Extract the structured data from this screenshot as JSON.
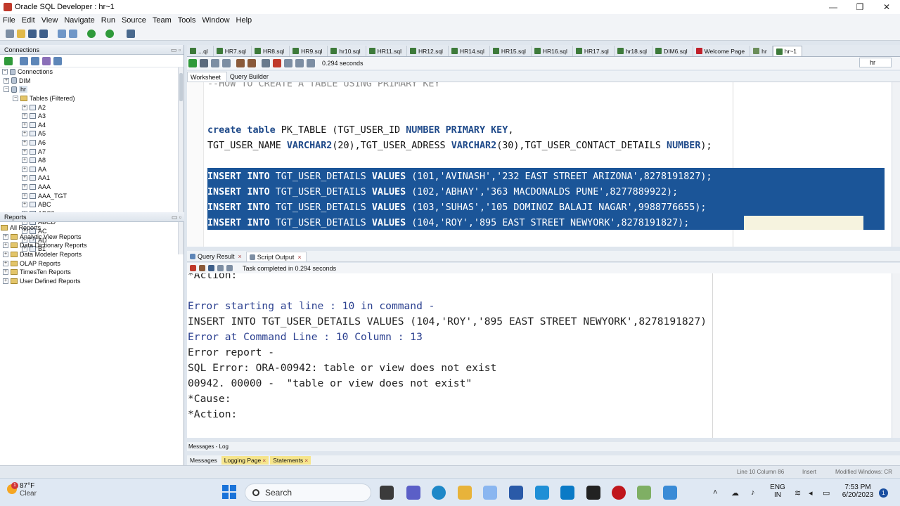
{
  "window": {
    "title": "Oracle SQL Developer : hr~1",
    "controls": [
      "—",
      "❐",
      "✕"
    ]
  },
  "menu": [
    "File",
    "Edit",
    "View",
    "Navigate",
    "Run",
    "Source",
    "Team",
    "Tools",
    "Window",
    "Help"
  ],
  "connections": {
    "header": "Connections",
    "root": "Connections",
    "dim": "DIM",
    "hr": "hr",
    "tables_folder": "Tables (Filtered)",
    "tables": [
      "A2",
      "A3",
      "A4",
      "A5",
      "A6",
      "A7",
      "A8",
      "AA",
      "AA1",
      "AAA",
      "AAA_TGT",
      "ABC",
      "ABC2",
      "ABCD",
      "AC",
      "AD",
      "B1"
    ]
  },
  "reports": {
    "header": "Reports",
    "items": [
      "All Reports",
      "Analytic View Reports",
      "Data Dictionary Reports",
      "Data Modeler Reports",
      "OLAP Reports",
      "TimesTen Reports",
      "User Defined Reports"
    ]
  },
  "editor_tabs": [
    "...ql",
    "HR7.sql",
    "HR8.sql",
    "HR9.sql",
    "hr10.sql",
    "HR11.sql",
    "HR12.sql",
    "HR14.sql",
    "HR15.sql",
    "HR16.sql",
    "HR17.sql",
    "hr18.sql",
    "DIM6.sql",
    "Welcome Page",
    "hr",
    "hr~1"
  ],
  "editor_toolbar": {
    "time": "0.294 seconds",
    "connection": "hr"
  },
  "worksheet_tabs": [
    "Worksheet",
    "Query Builder"
  ],
  "code": {
    "comment": "--HOW TO CREATE A TABLE USING PRIMARY KEY",
    "create_1_kw": "create table",
    "create_1_a": " PK_TABLE (TGT_USER_ID ",
    "create_1_kw2": "NUMBER PRIMARY KEY",
    "create_1_b": ",",
    "create_2_a": "TGT_USER_NAME ",
    "create_2_kw": "VARCHAR2",
    "create_2_b": "(20),TGT_USER_ADRESS ",
    "create_2_kw2": "VARCHAR2",
    "create_2_c": "(30),TGT_USER_CONTACT_DETAILS ",
    "create_2_kw3": "NUMBER",
    "create_2_d": ");",
    "ins_kw1": "INSERT INTO",
    "ins_table": " TGT_USER_DETAILS ",
    "ins_kw2": "VALUES",
    "ins_values": [
      " (101,'AVINASH','232 EAST STREET ARIZONA',8278191827);",
      " (102,'ABHAY','363 MACDONALDS PUNE',8277889922);",
      " (103,'SUHAS','105 DOMINOZ BALAJI NAGAR',9988776655);",
      " (104,'ROY','895 EAST STREET NEWYORK',8278191827);"
    ]
  },
  "output_tabs": [
    "Query Result",
    "Script Output"
  ],
  "output_status": "Task completed in 0.294 seconds",
  "output_lines": [
    "*Action:",
    "",
    "Error starting at line : 10 in command -",
    "INSERT INTO TGT_USER_DETAILS VALUES (104,'ROY','895 EAST STREET NEWYORK',8278191827)",
    "Error at Command Line : 10 Column : 13",
    "Error report -",
    "SQL Error: ORA-00942: table or view does not exist",
    "00942. 00000 -  \"table or view does not exist\"",
    "*Cause:",
    "*Action:"
  ],
  "messages": {
    "header": "Messages - Log",
    "tabs": [
      "Messages",
      "Logging Page",
      "Statements"
    ]
  },
  "statusbar": {
    "position": "Line 10 Column 86",
    "mode": "Insert",
    "state": "Modified Windows: CR"
  },
  "taskbar": {
    "weather_temp": "87°F",
    "weather_cond": "Clear",
    "weather_badge": "1",
    "search": "Search",
    "lang_1": "ENG",
    "lang_2": "IN",
    "time": "7:53 PM",
    "date": "6/20/2023",
    "notifications": "1"
  },
  "colors": {
    "selection": "#1b5598",
    "keyword": "#1f4a8a",
    "error_blue": "#2a3f8f"
  }
}
